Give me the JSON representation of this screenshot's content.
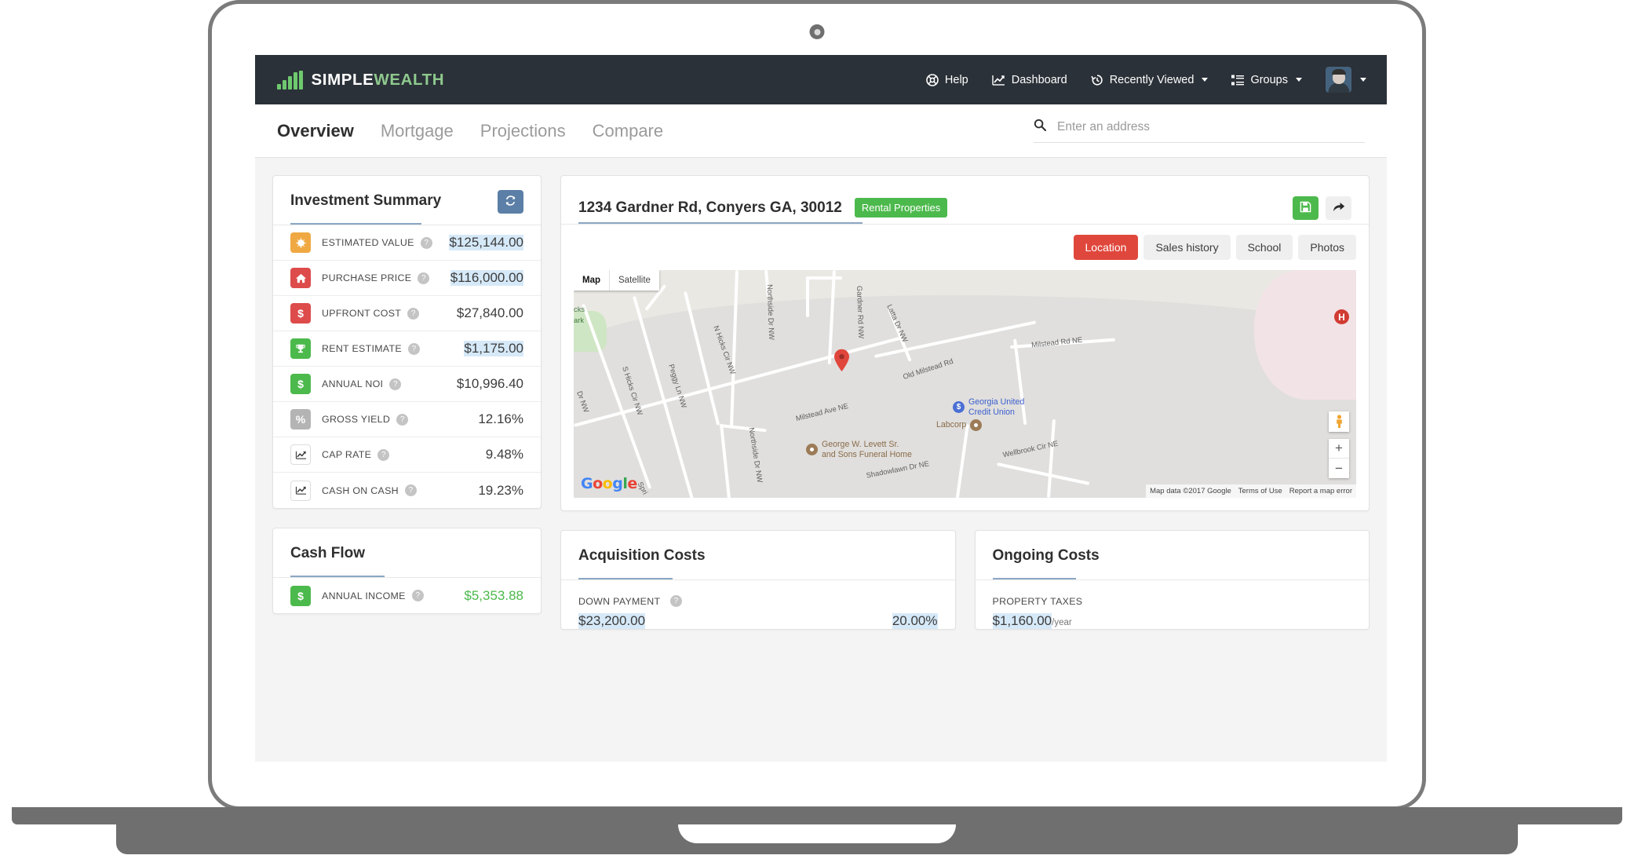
{
  "brand": {
    "part1": "SIMPLE",
    "part2": "WEALTH",
    "logo_icon": "bar-chart-logo-icon"
  },
  "navbar": {
    "items": [
      {
        "label": "Help",
        "icon": "life-ring-icon",
        "caret": false
      },
      {
        "label": "Dashboard",
        "icon": "line-chart-icon",
        "caret": false
      },
      {
        "label": "Recently Viewed",
        "icon": "history-clock-icon",
        "caret": true
      },
      {
        "label": "Groups",
        "icon": "list-icon",
        "caret": true
      }
    ],
    "avatar_icon": "user-avatar-icon"
  },
  "tabs": [
    {
      "label": "Overview",
      "active": true
    },
    {
      "label": "Mortgage",
      "active": false
    },
    {
      "label": "Projections",
      "active": false
    },
    {
      "label": "Compare",
      "active": false
    }
  ],
  "search": {
    "placeholder": "Enter an address",
    "value": "",
    "icon": "search-icon"
  },
  "investment_summary": {
    "title": "Investment Summary",
    "refresh_icon": "refresh-icon",
    "rows": [
      {
        "label": "ESTIMATED VALUE",
        "value": "$125,144.00",
        "icon": "sun-icon",
        "color": "orange",
        "highlighted": true
      },
      {
        "label": "PURCHASE PRICE",
        "value": "$116,000.00",
        "icon": "home-icon",
        "color": "red",
        "highlighted": true
      },
      {
        "label": "UPFRONT COST",
        "value": "$27,840.00",
        "icon": "dollar-icon",
        "color": "red",
        "highlighted": false
      },
      {
        "label": "RENT ESTIMATE",
        "value": "$1,175.00",
        "icon": "trophy-icon",
        "color": "green",
        "highlighted": true
      },
      {
        "label": "ANNUAL NOI",
        "value": "$10,996.40",
        "icon": "dollar-icon",
        "color": "green",
        "highlighted": false
      },
      {
        "label": "GROSS YIELD",
        "value": "12.16%",
        "icon": "percent-icon",
        "color": "grey",
        "highlighted": false
      },
      {
        "label": "CAP RATE",
        "value": "9.48%",
        "icon": "line-chart-icon",
        "color": "white",
        "highlighted": false
      },
      {
        "label": "CASH ON CASH",
        "value": "19.23%",
        "icon": "line-chart-icon",
        "color": "white",
        "highlighted": false
      }
    ],
    "help_glyph": "?"
  },
  "property": {
    "address": "1234 Gardner Rd, Conyers GA, 30012",
    "badge": "Rental Properties",
    "save_icon": "save-floppy-icon",
    "share_icon": "share-arrow-icon",
    "tabs": [
      {
        "label": "Location",
        "active": true
      },
      {
        "label": "Sales history",
        "active": false
      },
      {
        "label": "School",
        "active": false
      },
      {
        "label": "Photos",
        "active": false
      }
    ]
  },
  "map": {
    "type_buttons": [
      {
        "label": "Map",
        "active": true
      },
      {
        "label": "Satellite",
        "active": false
      }
    ],
    "pin_icon": "map-pin-icon",
    "pegman_icon": "street-view-pegman-icon",
    "zoom_in": "+",
    "zoom_out": "−",
    "hospital_marker": "H",
    "google_logo": "Google",
    "attribution": {
      "data": "Map data ©2017 Google",
      "terms": "Terms of Use",
      "report": "Report a map error"
    },
    "street_labels": [
      "S Hicks Cir NW",
      "Peggy Ln NW",
      "N Hicks Cir NW",
      "Northside Dr NW",
      "Northside Dr NW",
      "Gardner Rd NW",
      "Latta Dr NW",
      "Old Milstead Rd",
      "Milstead Rd NE",
      "Milstead Ave NE",
      "Wellbrook Cir NE",
      "Shadowlawn Dr NE",
      "Dr NW",
      "Spri"
    ],
    "park_label_line1": "cks",
    "park_label_line2": "ark",
    "pois": [
      {
        "name": "Georgia United\nCredit Union",
        "type": "bank",
        "color": "blue"
      },
      {
        "name": "Labcorp",
        "type": "business",
        "color": "brown"
      },
      {
        "name": "George W. Levett Sr.\nand Sons Funeral Home",
        "type": "business",
        "color": "brown"
      }
    ]
  },
  "cash_flow": {
    "title": "Cash Flow",
    "rows": [
      {
        "label": "ANNUAL INCOME",
        "value": "$5,353.88",
        "icon": "dollar-icon",
        "color": "green"
      }
    ]
  },
  "acquisition_costs": {
    "title": "Acquisition Costs",
    "rows": [
      {
        "label": "DOWN PAYMENT",
        "value": "$23,200.00",
        "percent": "20.00%",
        "highlighted": true
      }
    ]
  },
  "ongoing_costs": {
    "title": "Ongoing Costs",
    "rows": [
      {
        "label": "PROPERTY TAXES",
        "value": "$1,160.00",
        "unit": "/year",
        "highlighted": true
      }
    ]
  },
  "colors": {
    "navbar": "#2b3138",
    "brand_green": "#6ec96e",
    "accent_green": "#4cb94c",
    "accent_red": "#e0473c",
    "accent_blue": "#5b7fa6",
    "underline_blue": "#8ba7c4",
    "highlight": "#d6e9f8"
  }
}
